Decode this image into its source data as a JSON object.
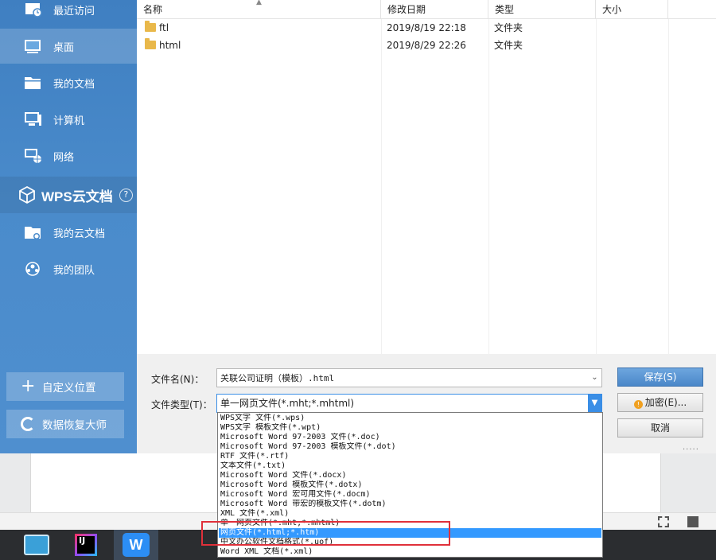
{
  "sidebar": {
    "items": [
      {
        "label": "最近访问",
        "icon": "recent-icon"
      },
      {
        "label": "桌面",
        "icon": "desktop-icon"
      },
      {
        "label": "我的文档",
        "icon": "folder-icon"
      },
      {
        "label": "计算机",
        "icon": "computer-icon"
      },
      {
        "label": "网络",
        "icon": "network-icon"
      }
    ],
    "wps_title": "WPS云文档",
    "help": "?",
    "cloud_items": [
      {
        "label": "我的云文档",
        "icon": "cloud-doc-icon"
      },
      {
        "label": "我的团队",
        "icon": "team-icon"
      }
    ],
    "custom_location": "自定义位置",
    "recovery": "数据恢复大师"
  },
  "filelist": {
    "headers": {
      "name": "名称",
      "modified": "修改日期",
      "type": "类型",
      "size": "大小"
    },
    "rows": [
      {
        "name": "ftl",
        "modified": "2019/8/19 22:18",
        "type": "文件夹"
      },
      {
        "name": "html",
        "modified": "2019/8/29 22:26",
        "type": "文件夹"
      }
    ]
  },
  "form": {
    "filename_label": "文件名(N)：",
    "filename_value": "关联公司证明（模板）.html",
    "filetype_label": "文件类型(T)：",
    "filetype_value": "单一网页文件(*.mht;*.mhtml)",
    "save": "保存(S)",
    "encrypt": "加密(E)...",
    "cancel": "取消"
  },
  "dropdown": {
    "options": [
      "WPS文字 文件(*.wps)",
      "WPS文字 模板文件(*.wpt)",
      "Microsoft Word 97-2003 文件(*.doc)",
      "Microsoft Word 97-2003 模板文件(*.dot)",
      "RTF 文件(*.rtf)",
      "文本文件(*.txt)",
      "Microsoft Word 文件(*.docx)",
      "Microsoft Word 模板文件(*.dotx)",
      "Microsoft Word 宏可用文件(*.docm)",
      "Microsoft Word 带宏的模板文件(*.dotm)",
      "XML 文件(*.xml)",
      "单一网页文件(*.mht;*.mhtml)",
      "网页文件(*.html;*.htm)",
      "中文办公软件文档格式(*.uof)",
      "Word XML 文档(*.xml)"
    ],
    "selected_index": 12
  },
  "taskbar": {
    "jetbrains_label": "IJ",
    "wps_label": "W"
  },
  "colors": {
    "sidebar": "#4a8bcb",
    "selection": "#3399ff",
    "highlight": "#e0303a",
    "primary_button": "#4a87c9"
  }
}
